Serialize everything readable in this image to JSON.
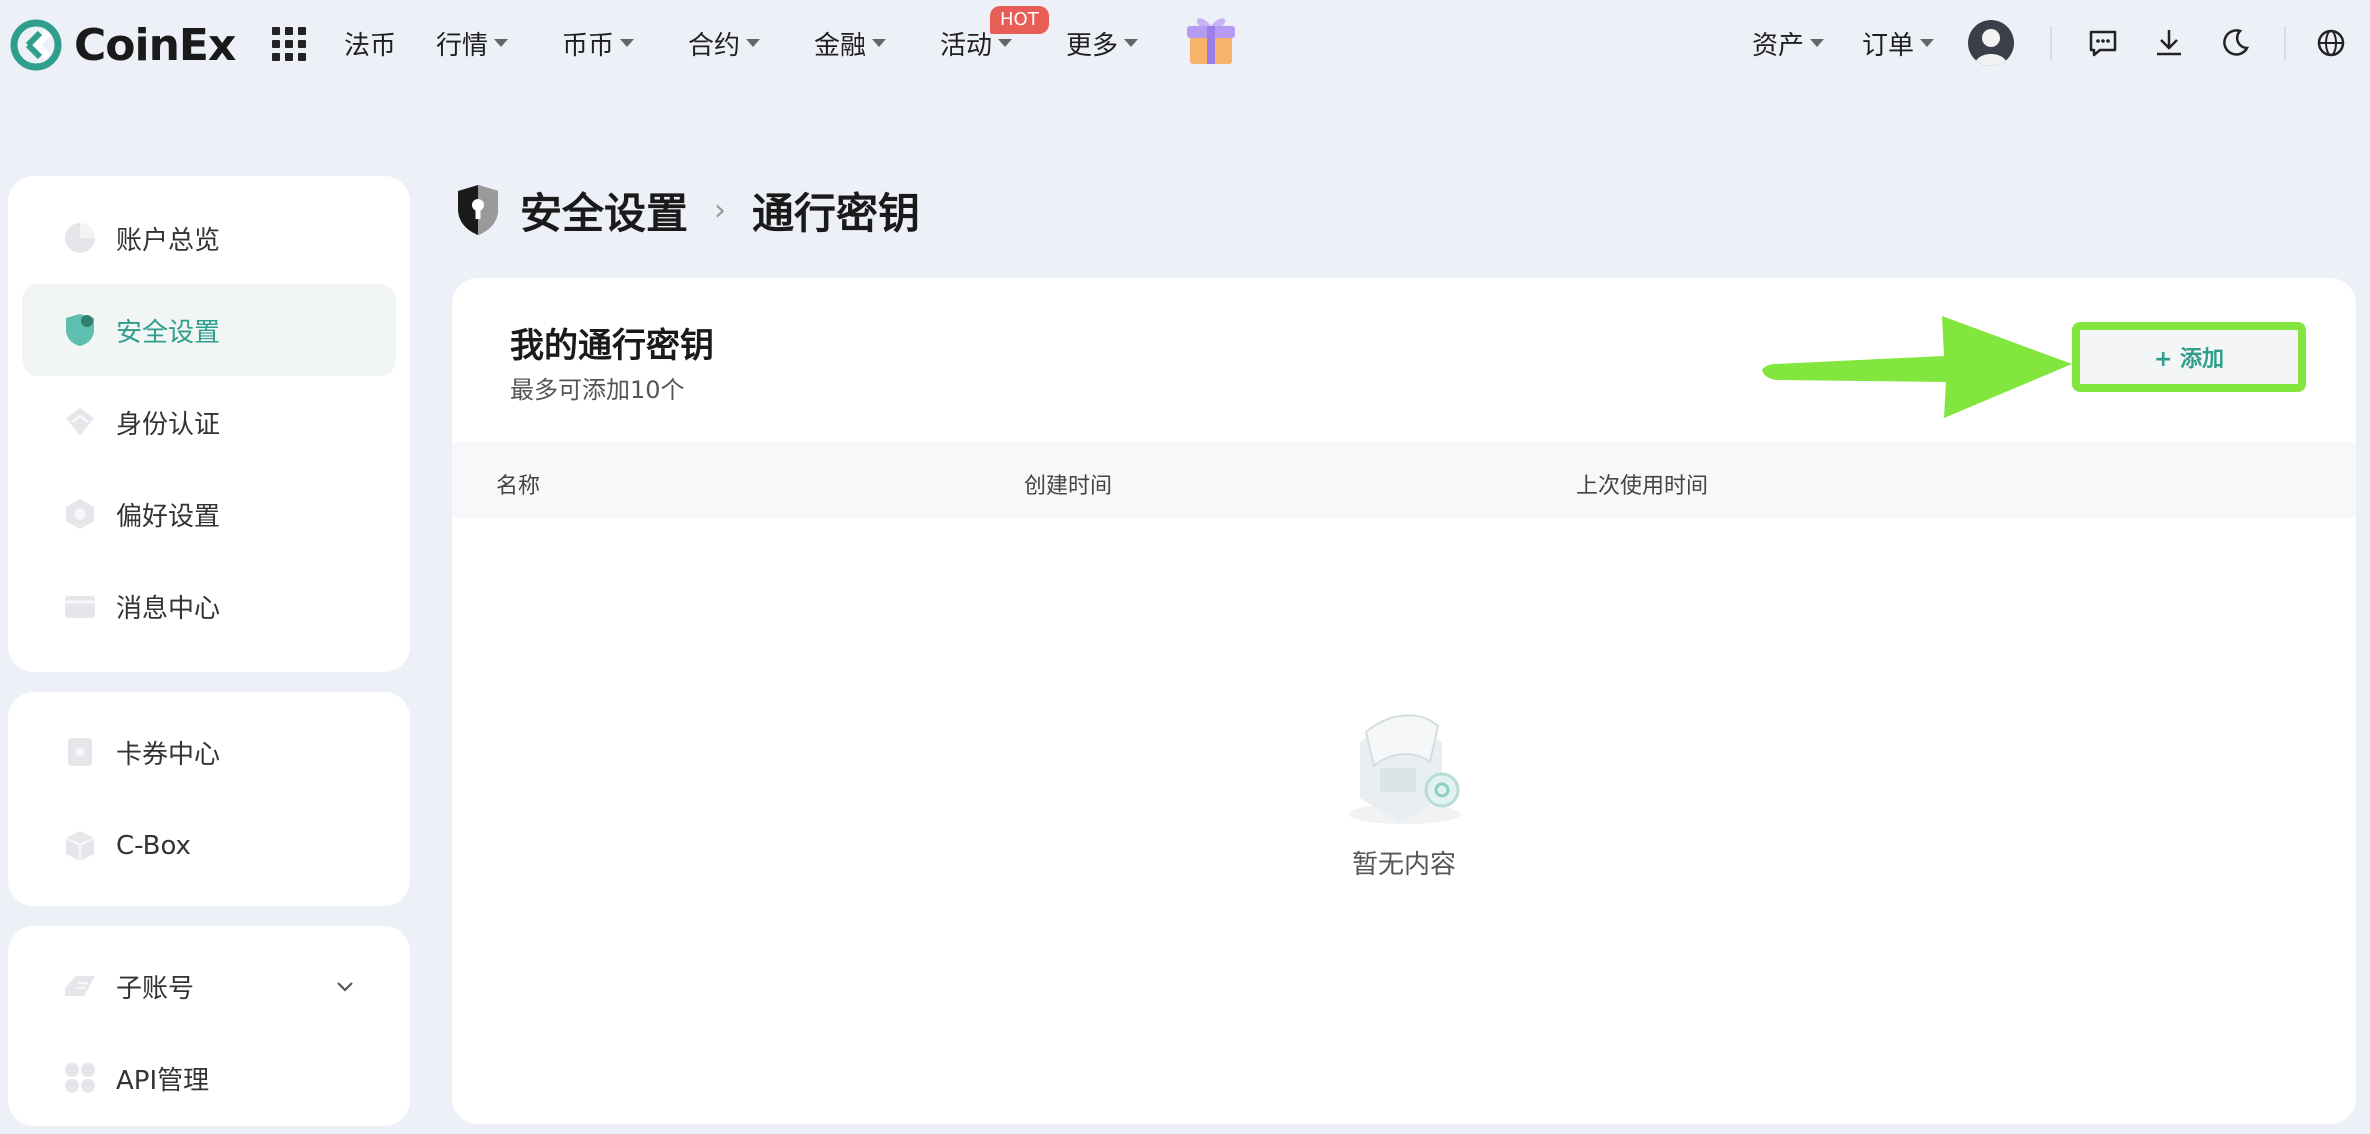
{
  "brand": {
    "name": "CoinEx",
    "accent": "#2f9e8c",
    "highlight": "#82e63f"
  },
  "nav": {
    "items": [
      {
        "label": "法币",
        "dropdown": false
      },
      {
        "label": "行情",
        "dropdown": true
      },
      {
        "label": "币币",
        "dropdown": true
      },
      {
        "label": "合约",
        "dropdown": true
      },
      {
        "label": "金融",
        "dropdown": true
      },
      {
        "label": "活动",
        "dropdown": true,
        "badge": "HOT"
      },
      {
        "label": "更多",
        "dropdown": true
      }
    ],
    "right": {
      "assets": "资产",
      "orders": "订单"
    }
  },
  "sidebar": {
    "group1": [
      {
        "label": "账户总览",
        "icon": "pie-chart-icon"
      },
      {
        "label": "安全设置",
        "icon": "shield-icon",
        "active": true
      },
      {
        "label": "身份认证",
        "icon": "id-card-icon"
      },
      {
        "label": "偏好设置",
        "icon": "settings-cube-icon"
      },
      {
        "label": "消息中心",
        "icon": "message-box-icon"
      }
    ],
    "group2": [
      {
        "label": "卡券中心",
        "icon": "coupon-icon"
      },
      {
        "label": "C-Box",
        "icon": "box-icon"
      }
    ],
    "group3": [
      {
        "label": "子账号",
        "icon": "sub-account-icon",
        "expandable": true
      },
      {
        "label": "API管理",
        "icon": "api-icon"
      }
    ]
  },
  "breadcrumb": {
    "parent": "安全设置",
    "current": "通行密钥"
  },
  "panel": {
    "title": "我的通行密钥",
    "subtitle": "最多可添加10个",
    "add_button": "+ 添加",
    "columns": [
      "名称",
      "创建时间",
      "上次使用时间"
    ],
    "empty_text": "暂无内容"
  }
}
